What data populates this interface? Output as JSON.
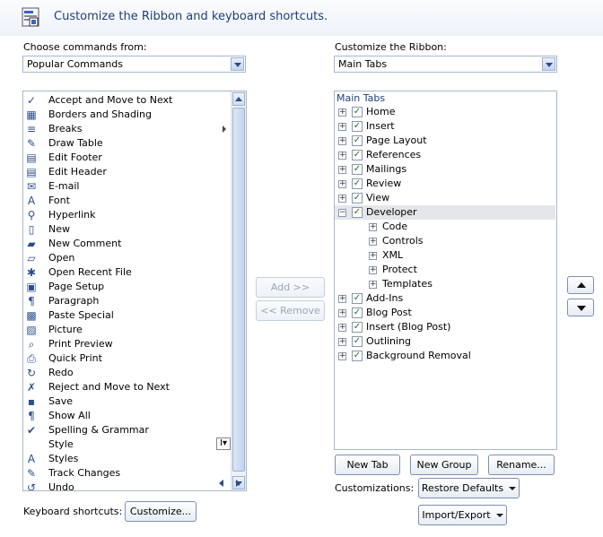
{
  "header": {
    "title": "Customize the Ribbon and keyboard shortcuts."
  },
  "left": {
    "label": "Choose commands from:",
    "combo_value": "Popular Commands",
    "commands": [
      {
        "label": "Accept and Move to Next",
        "icon": "✓",
        "icon_name": "accept-icon"
      },
      {
        "label": "Borders and Shading",
        "icon": "▦",
        "icon_name": "borders-icon"
      },
      {
        "label": "Breaks",
        "icon": "≡",
        "icon_name": "breaks-icon",
        "submenu": true
      },
      {
        "label": "Draw Table",
        "icon": "✎",
        "icon_name": "draw-table-icon"
      },
      {
        "label": "Edit Footer",
        "icon": "▤",
        "icon_name": "footer-icon"
      },
      {
        "label": "Edit Header",
        "icon": "▤",
        "icon_name": "header-icon"
      },
      {
        "label": "E-mail",
        "icon": "✉",
        "icon_name": "email-icon"
      },
      {
        "label": "Font",
        "icon": "A",
        "icon_name": "font-icon"
      },
      {
        "label": "Hyperlink",
        "icon": "⚲",
        "icon_name": "hyperlink-icon"
      },
      {
        "label": "New",
        "icon": "▯",
        "icon_name": "new-document-icon"
      },
      {
        "label": "New Comment",
        "icon": "▰",
        "icon_name": "comment-icon"
      },
      {
        "label": "Open",
        "icon": "▱",
        "icon_name": "open-folder-icon"
      },
      {
        "label": "Open Recent File",
        "icon": "✱",
        "icon_name": "recent-file-icon"
      },
      {
        "label": "Page Setup",
        "icon": "▣",
        "icon_name": "page-setup-icon"
      },
      {
        "label": "Paragraph",
        "icon": "¶",
        "icon_name": "paragraph-icon"
      },
      {
        "label": "Paste Special",
        "icon": "▩",
        "icon_name": "paste-icon"
      },
      {
        "label": "Picture",
        "icon": "▨",
        "icon_name": "picture-icon"
      },
      {
        "label": "Print Preview",
        "icon": "⌕",
        "icon_name": "print-preview-icon"
      },
      {
        "label": "Quick Print",
        "icon": "⎙",
        "icon_name": "printer-icon"
      },
      {
        "label": "Redo",
        "icon": "↻",
        "icon_name": "redo-icon"
      },
      {
        "label": "Reject and Move to Next",
        "icon": "✗",
        "icon_name": "reject-icon"
      },
      {
        "label": "Save",
        "icon": "▪",
        "icon_name": "save-icon"
      },
      {
        "label": "Show All",
        "icon": "¶",
        "icon_name": "show-all-icon"
      },
      {
        "label": "Spelling & Grammar",
        "icon": "✔",
        "icon_name": "spelling-icon"
      },
      {
        "label": "Style",
        "icon": "",
        "icon_name": "style-icon"
      },
      {
        "label": "Styles",
        "icon": "A",
        "icon_name": "styles-icon"
      },
      {
        "label": "Track Changes",
        "icon": "✎",
        "icon_name": "track-changes-icon"
      },
      {
        "label": "Undo",
        "icon": "↺",
        "icon_name": "undo-icon"
      }
    ],
    "style_cursor_glyph": "I▾"
  },
  "middle": {
    "add_label": "Add >>",
    "remove_label": "<< Remove"
  },
  "right": {
    "label": "Customize the Ribbon:",
    "combo_value": "Main Tabs",
    "tree_header": "Main Tabs",
    "tree": [
      {
        "label": "Home",
        "level": 0,
        "checked": true,
        "expander": "+"
      },
      {
        "label": "Insert",
        "level": 0,
        "checked": true,
        "expander": "+"
      },
      {
        "label": "Page Layout",
        "level": 0,
        "checked": true,
        "expander": "+"
      },
      {
        "label": "References",
        "level": 0,
        "checked": true,
        "expander": "+"
      },
      {
        "label": "Mailings",
        "level": 0,
        "checked": true,
        "expander": "+"
      },
      {
        "label": "Review",
        "level": 0,
        "checked": true,
        "expander": "+"
      },
      {
        "label": "View",
        "level": 0,
        "checked": true,
        "expander": "+"
      },
      {
        "label": "Developer",
        "level": 0,
        "checked": true,
        "expander": "−",
        "selected": true
      },
      {
        "label": "Code",
        "level": 1,
        "expander": "+"
      },
      {
        "label": "Controls",
        "level": 1,
        "expander": "+"
      },
      {
        "label": "XML",
        "level": 1,
        "expander": "+"
      },
      {
        "label": "Protect",
        "level": 1,
        "expander": "+"
      },
      {
        "label": "Templates",
        "level": 1,
        "expander": "+"
      },
      {
        "label": "Add-Ins",
        "level": 0,
        "checked": true,
        "expander": "+"
      },
      {
        "label": "Blog Post",
        "level": 0,
        "checked": true,
        "expander": "+"
      },
      {
        "label": "Insert (Blog Post)",
        "level": 0,
        "checked": true,
        "expander": "+"
      },
      {
        "label": "Outlining",
        "level": 0,
        "checked": true,
        "expander": "+"
      },
      {
        "label": "Background Removal",
        "level": 0,
        "checked": true,
        "expander": "+"
      }
    ],
    "new_tab_label": "New Tab",
    "new_group_label": "New Group",
    "rename_label": "Rename...",
    "customizations_label": "Customizations:",
    "restore_defaults_label": "Restore Defaults",
    "import_export_label": "Import/Export"
  },
  "footer": {
    "keyboard_label": "Keyboard shortcuts:",
    "customize_label": "Customize..."
  }
}
